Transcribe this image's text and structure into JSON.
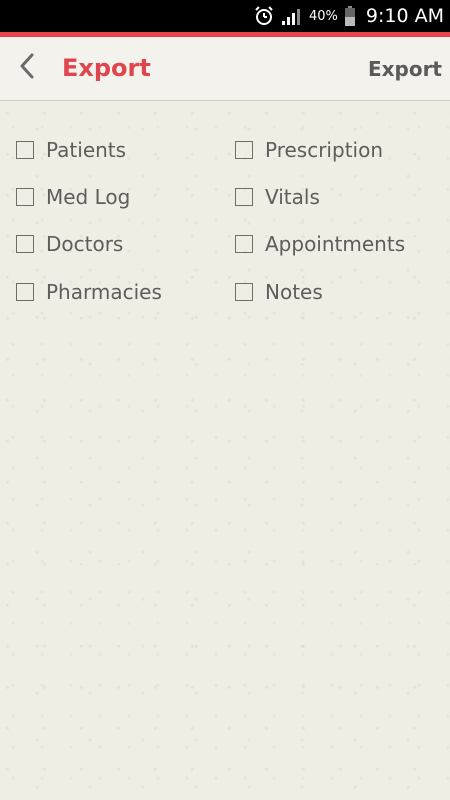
{
  "status_bar": {
    "battery_percent": "40%",
    "time": "9:10 AM",
    "icons": [
      "alarm-icon",
      "signal-icon",
      "battery-icon"
    ]
  },
  "colors": {
    "accent": "#e8454f",
    "title": "#e0454d",
    "background": "#efede4"
  },
  "header": {
    "back_icon": "chevron-left-icon",
    "title": "Export",
    "action_label": "Export"
  },
  "options": {
    "left": [
      {
        "label": "Patients",
        "checked": false
      },
      {
        "label": "Med Log",
        "checked": false
      },
      {
        "label": "Doctors",
        "checked": false
      },
      {
        "label": "Pharmacies",
        "checked": false
      }
    ],
    "right": [
      {
        "label": "Prescription",
        "checked": false
      },
      {
        "label": "Vitals",
        "checked": false
      },
      {
        "label": "Appointments",
        "checked": false
      },
      {
        "label": "Notes",
        "checked": false
      }
    ]
  }
}
